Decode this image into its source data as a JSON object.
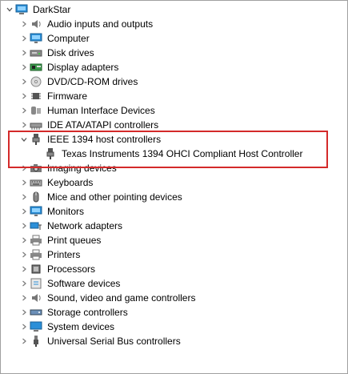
{
  "root": {
    "label": "DarkStar",
    "icon": "computer-root-icon"
  },
  "categories": [
    {
      "label": "Audio inputs and outputs",
      "icon": "speaker-icon"
    },
    {
      "label": "Computer",
      "icon": "monitor-icon"
    },
    {
      "label": "Disk drives",
      "icon": "disk-drive-icon"
    },
    {
      "label": "Display adapters",
      "icon": "display-adapter-icon"
    },
    {
      "label": "DVD/CD-ROM drives",
      "icon": "optical-drive-icon"
    },
    {
      "label": "Firmware",
      "icon": "firmware-chip-icon"
    },
    {
      "label": "Human Interface Devices",
      "icon": "hid-icon"
    },
    {
      "label": "IDE ATA/ATAPI controllers",
      "icon": "ide-controller-icon"
    },
    {
      "label": "IEEE 1394 host controllers",
      "icon": "firewire-plug-icon",
      "expanded": true,
      "children": [
        {
          "label": "Texas Instruments 1394 OHCI Compliant Host Controller",
          "icon": "firewire-plug-icon"
        }
      ]
    },
    {
      "label": "Imaging devices",
      "icon": "camera-icon"
    },
    {
      "label": "Keyboards",
      "icon": "keyboard-icon"
    },
    {
      "label": "Mice and other pointing devices",
      "icon": "mouse-icon"
    },
    {
      "label": "Monitors",
      "icon": "monitor-icon"
    },
    {
      "label": "Network adapters",
      "icon": "network-adapter-icon"
    },
    {
      "label": "Print queues",
      "icon": "printer-icon"
    },
    {
      "label": "Printers",
      "icon": "printer-icon"
    },
    {
      "label": "Processors",
      "icon": "cpu-icon"
    },
    {
      "label": "Software devices",
      "icon": "software-device-icon"
    },
    {
      "label": "Sound, video and game controllers",
      "icon": "speaker-icon"
    },
    {
      "label": "Storage controllers",
      "icon": "storage-controller-icon"
    },
    {
      "label": "System devices",
      "icon": "system-device-icon"
    },
    {
      "label": "Universal Serial Bus controllers",
      "icon": "usb-plug-icon"
    }
  ],
  "colors": {
    "highlight_border": "#d42a2a",
    "chevron": "#7a7a7a"
  }
}
